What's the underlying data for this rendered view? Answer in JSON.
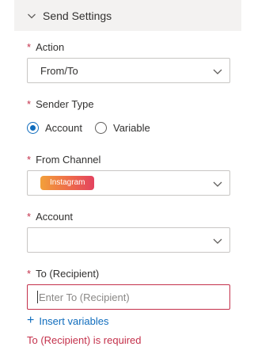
{
  "section": {
    "title": "Send Settings",
    "icon": "chevron-down-icon"
  },
  "required_mark": "*",
  "action": {
    "label": "Action",
    "value": "From/To"
  },
  "sender_type": {
    "label": "Sender Type",
    "options": [
      {
        "label": "Account",
        "checked": true
      },
      {
        "label": "Variable",
        "checked": false
      }
    ]
  },
  "from_channel": {
    "label": "From Channel",
    "badge": "Instagram",
    "badge_colors": [
      "#f2a03a",
      "#e3435f"
    ]
  },
  "account": {
    "label": "Account",
    "value": ""
  },
  "recipient": {
    "label": "To (Recipient)",
    "placeholder": "Enter To (Recipient)",
    "value": ""
  },
  "insert_variables": {
    "label": "Insert variables",
    "icon": "plus-icon"
  },
  "error_text": "To (Recipient) is required",
  "colors": {
    "accent": "#0f6cbd",
    "error": "#c4314b",
    "header_bg": "#f3f2f1"
  }
}
